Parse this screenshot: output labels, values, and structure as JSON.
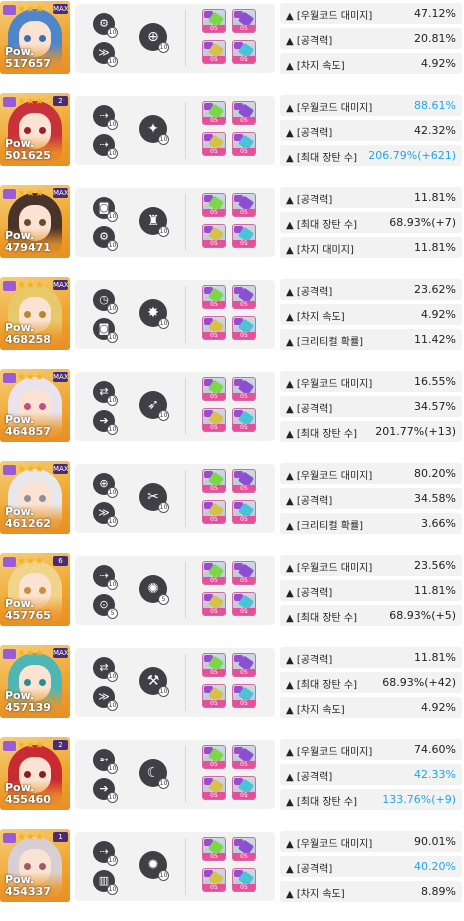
{
  "colors": {
    "highlight": "#1fa6e8",
    "level_badge": "#e4509a",
    "power_band": "#e98f25",
    "skill_bg": "#3f3f45"
  },
  "entries": [
    {
      "power_label": "Pow.",
      "power": "517657",
      "stars": "★★★",
      "level_badge": "MAX",
      "hair": "#4f86c9",
      "eye": "#3a6fb0",
      "skills": [
        {
          "icon": "drone-icon",
          "glyph": "⚙",
          "level": "10"
        },
        {
          "icon": "ammo-icon",
          "glyph": "≫",
          "level": "10"
        },
        {
          "icon": "crosshair-icon",
          "glyph": "⊕",
          "level": "10"
        }
      ],
      "cubes": [
        "05",
        "05",
        "05",
        "05"
      ],
      "stats": [
        {
          "name": "▲ [우월코드 대미지]",
          "value": "47.12%",
          "hl": false
        },
        {
          "name": "▲ [공격력]",
          "value": "20.81%",
          "hl": false
        },
        {
          "name": "▲ [차지 속도]",
          "value": "4.92%",
          "hl": false
        }
      ]
    },
    {
      "power_label": "Pow.",
      "power": "501625",
      "stars": "★★★",
      "level_badge": "2",
      "hair": "#c8323b",
      "eye": "#9e1f2a",
      "skills": [
        {
          "icon": "dash-icon",
          "glyph": "⇢",
          "level": "10"
        },
        {
          "icon": "dash-icon",
          "glyph": "⇢",
          "level": "10"
        },
        {
          "icon": "burst-icon",
          "glyph": "✦",
          "level": "10"
        }
      ],
      "cubes": [
        "05",
        "05",
        "05",
        "05"
      ],
      "stats": [
        {
          "name": "▲ [우월코드 대미지]",
          "value": "88.61%",
          "hl": true
        },
        {
          "name": "▲ [공격력]",
          "value": "42.32%",
          "hl": false
        },
        {
          "name": "▲ [최대 장탄 수]",
          "value": "206.79%(+621)",
          "hl": true
        }
      ]
    },
    {
      "power_label": "Pow.",
      "power": "479471",
      "stars": "★★★",
      "level_badge": "MAX",
      "hair": "#4a3328",
      "eye": "#6b4a2c",
      "skills": [
        {
          "icon": "camera-icon",
          "glyph": "◙",
          "level": "10"
        },
        {
          "icon": "gear-icon",
          "glyph": "⚙",
          "level": "10"
        },
        {
          "icon": "bell-icon",
          "glyph": "♜",
          "level": "10"
        }
      ],
      "cubes": [
        "05",
        "05",
        "05",
        "05"
      ],
      "stats": [
        {
          "name": "▲ [공격력]",
          "value": "11.81%",
          "hl": false
        },
        {
          "name": "▲ [최대 장탄 수]",
          "value": "68.93%(+7)",
          "hl": false
        },
        {
          "name": "▲ [차지 대미지]",
          "value": "11.81%",
          "hl": false
        }
      ]
    },
    {
      "power_label": "Pow.",
      "power": "468258",
      "stars": "★★★",
      "level_badge": "MAX",
      "hair": "#e8c96a",
      "eye": "#b9862f",
      "skills": [
        {
          "icon": "timer-icon",
          "glyph": "◷",
          "level": "10"
        },
        {
          "icon": "camera-icon",
          "glyph": "◙",
          "level": "10"
        },
        {
          "icon": "bomb-icon",
          "glyph": "✸",
          "level": "10"
        }
      ],
      "cubes": [
        "05",
        "05",
        "05",
        "05"
      ],
      "stats": [
        {
          "name": "▲ [공격력]",
          "value": "23.62%",
          "hl": false
        },
        {
          "name": "▲ [차지 속도]",
          "value": "4.92%",
          "hl": false
        },
        {
          "name": "▲ [크리티컬 확률]",
          "value": "11.42%",
          "hl": false
        }
      ]
    },
    {
      "power_label": "Pow.",
      "power": "464857",
      "stars": "★★★",
      "level_badge": "MAX",
      "hair": "#e9e3ee",
      "eye": "#c24d84",
      "skills": [
        {
          "icon": "arrows-icon",
          "glyph": "⇄",
          "level": "10"
        },
        {
          "icon": "arrow-icon",
          "glyph": "➔",
          "level": "10"
        },
        {
          "icon": "rocket-icon",
          "glyph": "➶",
          "level": "10"
        }
      ],
      "cubes": [
        "05",
        "05",
        "05",
        "05"
      ],
      "stats": [
        {
          "name": "▲ [우월코드 대미지]",
          "value": "16.55%",
          "hl": false
        },
        {
          "name": "▲ [공격력]",
          "value": "34.57%",
          "hl": false
        },
        {
          "name": "▲ [최대 장탄 수]",
          "value": "201.77%(+13)",
          "hl": false
        }
      ]
    },
    {
      "power_label": "Pow.",
      "power": "461262",
      "stars": "★★★",
      "level_badge": "MAX",
      "hair": "#e8e8ec",
      "eye": "#8b8f9c",
      "skills": [
        {
          "icon": "crosshair-icon",
          "glyph": "⊕",
          "level": "10"
        },
        {
          "icon": "ammo-icon",
          "glyph": "≫",
          "level": "10"
        },
        {
          "icon": "scissors-icon",
          "glyph": "✂",
          "level": "10"
        }
      ],
      "cubes": [
        "05",
        "05",
        "05",
        "05"
      ],
      "stats": [
        {
          "name": "▲ [우월코드 대미지]",
          "value": "80.20%",
          "hl": false
        },
        {
          "name": "▲ [공격력]",
          "value": "34.58%",
          "hl": false
        },
        {
          "name": "▲ [크리티컬 확률]",
          "value": "3.66%",
          "hl": false
        }
      ]
    },
    {
      "power_label": "Pow.",
      "power": "457765",
      "stars": "★★★",
      "level_badge": "6",
      "hair": "#f2d38a",
      "eye": "#c98e3f",
      "skills": [
        {
          "icon": "dash-icon",
          "glyph": "⇢",
          "level": "10"
        },
        {
          "icon": "compass-icon",
          "glyph": "⊙",
          "level": "5"
        },
        {
          "icon": "swirl-icon",
          "glyph": "✺",
          "level": "5"
        }
      ],
      "cubes": [
        "05",
        "05",
        "05",
        "05"
      ],
      "stats": [
        {
          "name": "▲ [우월코드 대미지]",
          "value": "23.56%",
          "hl": false
        },
        {
          "name": "▲ [공격력]",
          "value": "11.81%",
          "hl": false
        },
        {
          "name": "▲ [최대 장탄 수]",
          "value": "68.93%(+5)",
          "hl": false
        }
      ]
    },
    {
      "power_label": "Pow.",
      "power": "457139",
      "stars": "★★★",
      "level_badge": "MAX",
      "hair": "#4eb7b4",
      "eye": "#2e8b8f",
      "skills": [
        {
          "icon": "arrows-icon",
          "glyph": "⇄",
          "level": "10"
        },
        {
          "icon": "ammo-icon",
          "glyph": "≫",
          "level": "10"
        },
        {
          "icon": "tools-icon",
          "glyph": "⚒",
          "level": "10"
        }
      ],
      "cubes": [
        "05",
        "05",
        "05",
        "05"
      ],
      "stats": [
        {
          "name": "▲ [공격력]",
          "value": "11.81%",
          "hl": false
        },
        {
          "name": "▲ [최대 장탄 수]",
          "value": "68.93%(+42)",
          "hl": false
        },
        {
          "name": "▲ [차지 속도]",
          "value": "4.92%",
          "hl": false
        }
      ]
    },
    {
      "power_label": "Pow.",
      "power": "455460",
      "stars": "★★★",
      "level_badge": "2",
      "hair": "#c92b33",
      "eye": "#8c1c24",
      "skills": [
        {
          "icon": "bullet-icon",
          "glyph": "➵",
          "level": "10"
        },
        {
          "icon": "arrow-icon",
          "glyph": "➔",
          "level": "10"
        },
        {
          "icon": "moon-icon",
          "glyph": "☾",
          "level": "10"
        }
      ],
      "cubes": [
        "05",
        "05",
        "05",
        "05"
      ],
      "stats": [
        {
          "name": "▲ [우월코드 대미지]",
          "value": "74.60%",
          "hl": false
        },
        {
          "name": "▲ [공격력]",
          "value": "42.33%",
          "hl": true
        },
        {
          "name": "▲ [최대 장탄 수]",
          "value": "133.76%(+9)",
          "hl": true
        }
      ]
    },
    {
      "power_label": "Pow.",
      "power": "454337",
      "stars": "★★★",
      "level_badge": "1",
      "hair": "#d7cfd3",
      "eye": "#9b5b6a",
      "skills": [
        {
          "icon": "dash-icon",
          "glyph": "⇢",
          "level": "10"
        },
        {
          "icon": "magazine-icon",
          "glyph": "▥",
          "level": "10"
        },
        {
          "icon": "bolt-icon",
          "glyph": "✹",
          "level": "10"
        }
      ],
      "cubes": [
        "05",
        "05",
        "05",
        "05"
      ],
      "stats": [
        {
          "name": "▲ [우월코드 대미지]",
          "value": "90.01%",
          "hl": false
        },
        {
          "name": "▲ [공격력]",
          "value": "40.20%",
          "hl": true
        },
        {
          "name": "▲ [차지 속도]",
          "value": "8.89%",
          "hl": false
        }
      ]
    }
  ]
}
